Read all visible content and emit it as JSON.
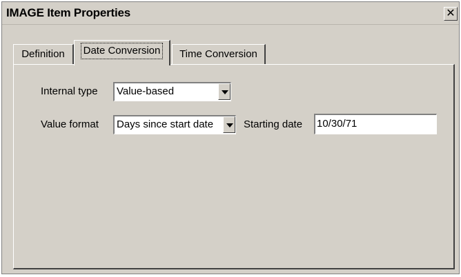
{
  "window": {
    "title": "IMAGE Item Properties",
    "close_glyph": "✕"
  },
  "tabs": [
    {
      "label": "Definition",
      "active": false
    },
    {
      "label": "Date Conversion",
      "active": true
    },
    {
      "label": "Time Conversion",
      "active": false
    }
  ],
  "date_conversion": {
    "internal_type": {
      "label": "Internal type",
      "value": "Value-based"
    },
    "value_format": {
      "label": "Value format",
      "value": "Days since start date"
    },
    "starting_date": {
      "label": "Starting date",
      "value": "10/30/71"
    }
  }
}
